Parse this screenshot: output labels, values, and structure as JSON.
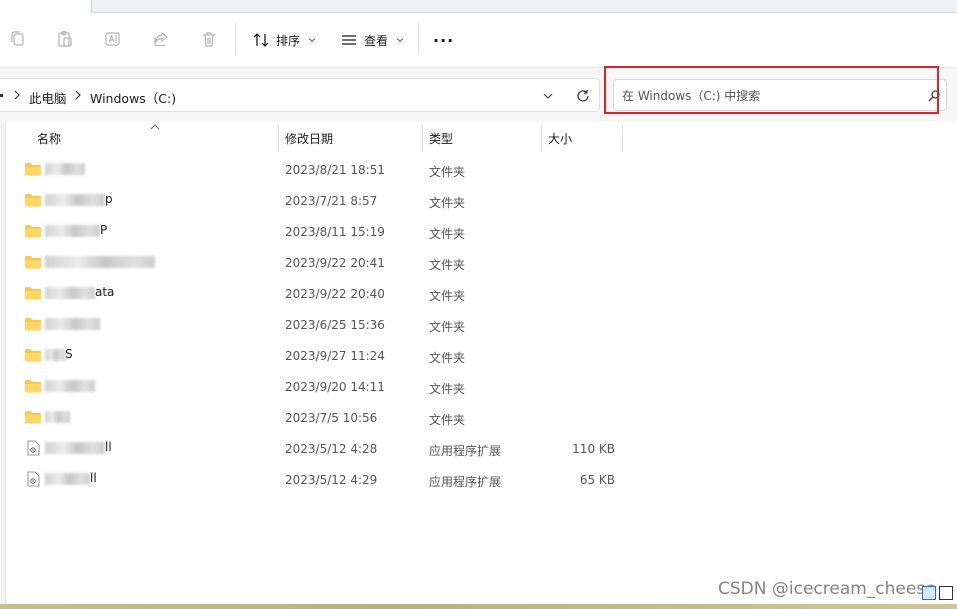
{
  "toolbar": {
    "sort_label": "排序",
    "view_label": "查看",
    "more_label": "···",
    "icons": [
      "copy-icon",
      "paste-icon",
      "rename-icon",
      "share-icon",
      "delete-icon",
      "sort-icon",
      "view-icon"
    ]
  },
  "address": {
    "crumbs": [
      "此电脑",
      "Windows（C:)"
    ],
    "search_placeholder": "在 Windows（C:) 中搜索"
  },
  "columns": {
    "name": "名称",
    "date": "修改日期",
    "type": "类型",
    "size": "大小"
  },
  "files": [
    {
      "name": "",
      "date": "2023/8/21 18:51",
      "type": "文件夹",
      "size": "",
      "kind": "folder"
    },
    {
      "name": "p",
      "date": "2023/7/21 8:57",
      "type": "文件夹",
      "size": "",
      "kind": "folder"
    },
    {
      "name": "P",
      "date": "2023/8/11 15:19",
      "type": "文件夹",
      "size": "",
      "kind": "folder"
    },
    {
      "name": "",
      "date": "2023/9/22 20:41",
      "type": "文件夹",
      "size": "",
      "kind": "folder"
    },
    {
      "name": "ata",
      "date": "2023/9/22 20:40",
      "type": "文件夹",
      "size": "",
      "kind": "folder"
    },
    {
      "name": "",
      "date": "2023/6/25 15:36",
      "type": "文件夹",
      "size": "",
      "kind": "folder"
    },
    {
      "name": "S",
      "date": "2023/9/27 11:24",
      "type": "文件夹",
      "size": "",
      "kind": "folder"
    },
    {
      "name": "",
      "date": "2023/9/20 14:11",
      "type": "文件夹",
      "size": "",
      "kind": "folder"
    },
    {
      "name": "",
      "date": "2023/7/5 10:56",
      "type": "文件夹",
      "size": "",
      "kind": "folder"
    },
    {
      "name": "ll",
      "date": "2023/5/12 4:28",
      "type": "应用程序扩展",
      "size": "110 KB",
      "kind": "dll"
    },
    {
      "name": "ll",
      "date": "2023/5/12 4:29",
      "type": "应用程序扩展",
      "size": "65 KB",
      "kind": "dll"
    }
  ],
  "watermark": "CSDN @icecream_cheese",
  "colors": {
    "highlight": "#e0202a",
    "folder": "#f4c430"
  }
}
